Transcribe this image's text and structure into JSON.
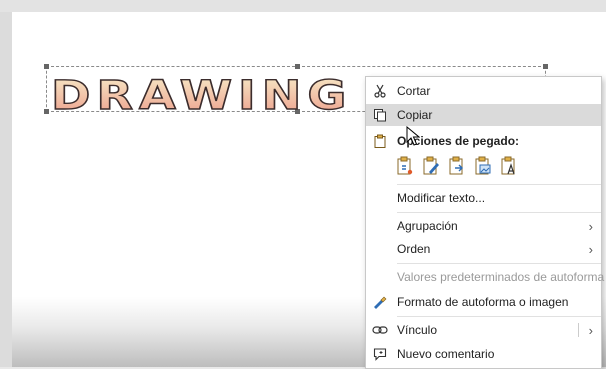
{
  "wordart": {
    "text": "DRAWING WITH"
  },
  "context_menu": {
    "cut": {
      "label": "Cortar",
      "icon": "scissors-icon"
    },
    "copy": {
      "label": "Copiar",
      "icon": "copy-icon"
    },
    "paste_options": {
      "label": "Opciones de pegado:",
      "icon": "clipboard-icon"
    },
    "paste_buttons": [
      {
        "name": "paste-keep-source-format",
        "icon": "paste-keep-format-icon"
      },
      {
        "name": "paste-use-destination-theme",
        "icon": "paste-theme-icon"
      },
      {
        "name": "paste-merge-format",
        "icon": "paste-merge-icon"
      },
      {
        "name": "paste-picture",
        "icon": "paste-picture-icon"
      },
      {
        "name": "paste-text-only",
        "icon": "paste-text-icon"
      }
    ],
    "edit_text": {
      "label": "Modificar texto..."
    },
    "group": {
      "label": "Agrupación"
    },
    "order": {
      "label": "Orden"
    },
    "defaults": {
      "label": "Valores predeterminados de autoforma"
    },
    "format": {
      "label": "Formato de autoforma o imagen",
      "icon": "format-shape-icon"
    },
    "link": {
      "label": "Vínculo",
      "icon": "link-icon"
    },
    "comment": {
      "label": "Nuevo comentario",
      "icon": "comment-icon"
    }
  },
  "colors": {
    "accent_blue": "#2f6db5",
    "wordart_top": "#f6e6c0",
    "wordart_bottom": "#eea08c",
    "hover_bg": "#dadada"
  }
}
